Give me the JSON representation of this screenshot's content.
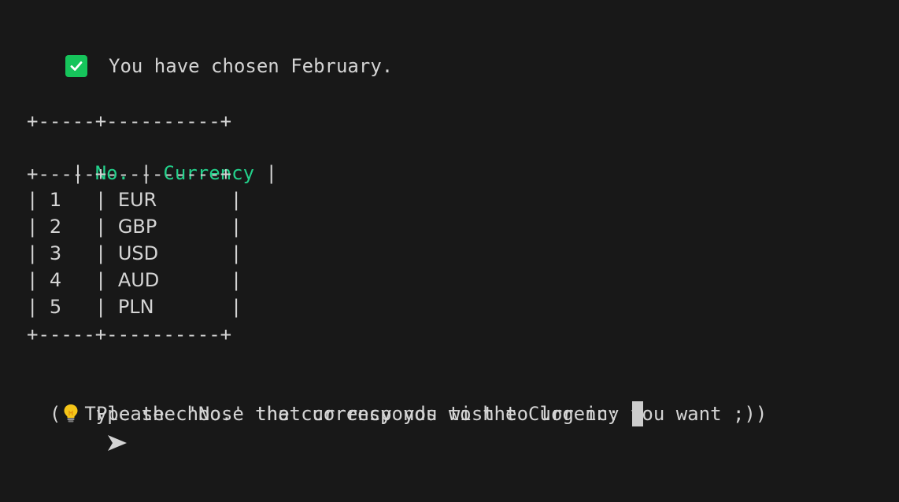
{
  "status": {
    "message": "You have chosen February."
  },
  "table": {
    "border_line": "+-----+----------+",
    "headers": [
      "No.",
      "Currency"
    ],
    "rows": [
      {
        "no": "1",
        "currency": "EUR"
      },
      {
        "no": "2",
        "currency": "GBP"
      },
      {
        "no": "3",
        "currency": "USD"
      },
      {
        "no": "4",
        "currency": "AUD"
      },
      {
        "no": "5",
        "currency": "PLN"
      }
    ]
  },
  "hint": {
    "open_paren": "(",
    "text": "Type the 'No.' that corresponds to the Currency you want ;))"
  },
  "prompt": {
    "text": "Please choose the currency you wish to log in:"
  },
  "icons": {
    "status": "check-icon",
    "hint": "lightbulb-icon",
    "prompt": "arrow-right-icon"
  },
  "colors": {
    "background": "#181818",
    "text": "#d4d4d4",
    "header_green": "#23d18b",
    "check_green": "#16c45b"
  }
}
